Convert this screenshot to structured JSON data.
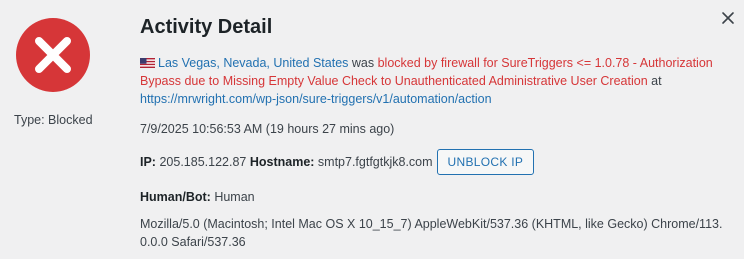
{
  "dialog": {
    "title": "Activity Detail",
    "close_glyph": "✕",
    "type_label": "Type: Blocked",
    "status_icon": "blocked-x-icon",
    "colors": {
      "blocked": "#d63638",
      "link": "#2271b1",
      "background": "#f0f0f1"
    }
  },
  "event": {
    "location": "Las Vegas, Nevada, United States",
    "country_flag": "us-flag-icon",
    "was_text": " was ",
    "block_reason": "blocked by firewall for SureTriggers <= 1.0.78 - Authorization Bypass due to Missing Empty Value Check to Unauthenticated Administrative User Creation",
    "at_text": " at ",
    "url": "https://mrwright.com/wp-json/sure-triggers/v1/automation/action",
    "timestamp": "7/9/2025 10:56:53 AM (19 hours 27 mins ago)",
    "ip_label": "IP:",
    "ip_value": "205.185.122.87",
    "hostname_label": "Hostname:",
    "hostname_value": "smtp7.fgtfgtkjk8.com",
    "unblock_button": "UNBLOCK IP",
    "human_bot_label": "Human/Bot:",
    "human_bot_value": "Human",
    "user_agent": "Mozilla/5.0 (Macintosh; Intel Mac OS X 10_15_7) AppleWebKit/537.36 (KHTML, like Gecko) Chrome/113.0.0.0 Safari/537.36"
  }
}
